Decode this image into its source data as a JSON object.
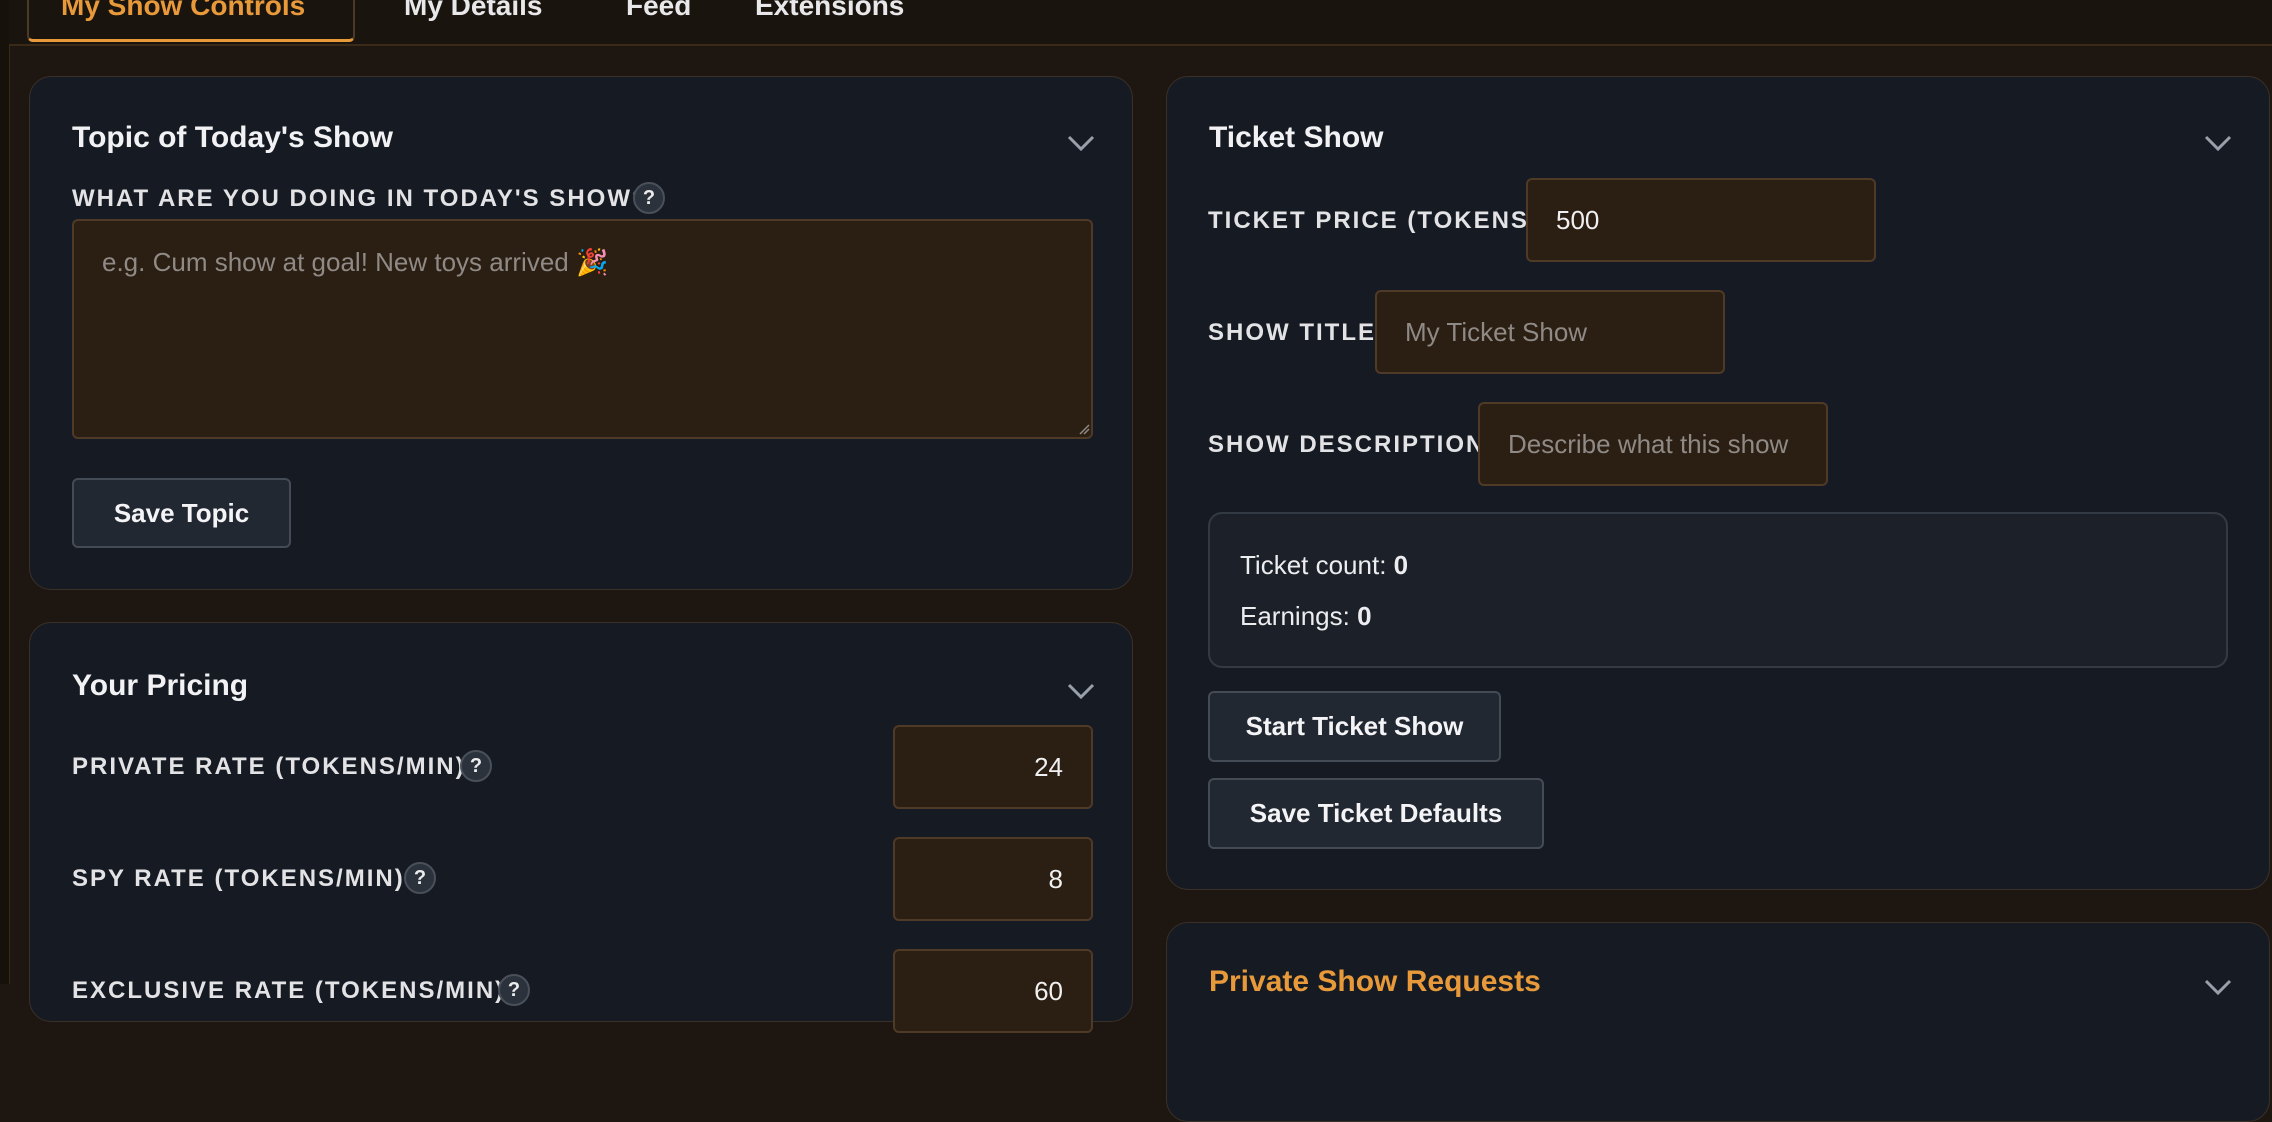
{
  "tabs": [
    {
      "label": "My Show Controls",
      "active": true
    },
    {
      "label": "My Details"
    },
    {
      "label": "Feed"
    },
    {
      "label": "Extensions"
    }
  ],
  "topic_panel": {
    "title": "Topic of Today's Show",
    "question_label": "WHAT ARE YOU DOING IN TODAY'S SHOW?",
    "help": "?",
    "textarea_placeholder": "e.g. Cum show at goal! New toys arrived 🎉",
    "save_button": "Save Topic"
  },
  "pricing_panel": {
    "title": "Your Pricing",
    "rows": [
      {
        "label": "PRIVATE RATE (TOKENS/MIN)",
        "help": "?",
        "value": "24"
      },
      {
        "label": "SPY RATE (TOKENS/MIN)",
        "help": "?",
        "value": "8"
      },
      {
        "label": "EXCLUSIVE RATE (TOKENS/MIN)",
        "help": "?",
        "value": "60"
      }
    ]
  },
  "ticket_panel": {
    "title": "Ticket Show",
    "price_label": "TICKET PRICE (TOKENS)",
    "price_value": "500",
    "title_label": "SHOW TITLE",
    "title_placeholder": "My Ticket Show",
    "desc_label": "SHOW DESCRIPTION",
    "desc_placeholder": "Describe what this show",
    "ticket_count_label": "Ticket count:",
    "ticket_count": "0",
    "earnings_label": "Earnings:",
    "earnings": "0",
    "start_button": "Start Ticket Show",
    "save_defaults_button": "Save Ticket Defaults"
  },
  "private_requests_panel": {
    "title": "Private Show Requests"
  },
  "colors": {
    "accent": "#e89a3a",
    "panel_bg": "#161b23",
    "input_bg": "#2b1e13",
    "page_bg": "#1e1610"
  }
}
